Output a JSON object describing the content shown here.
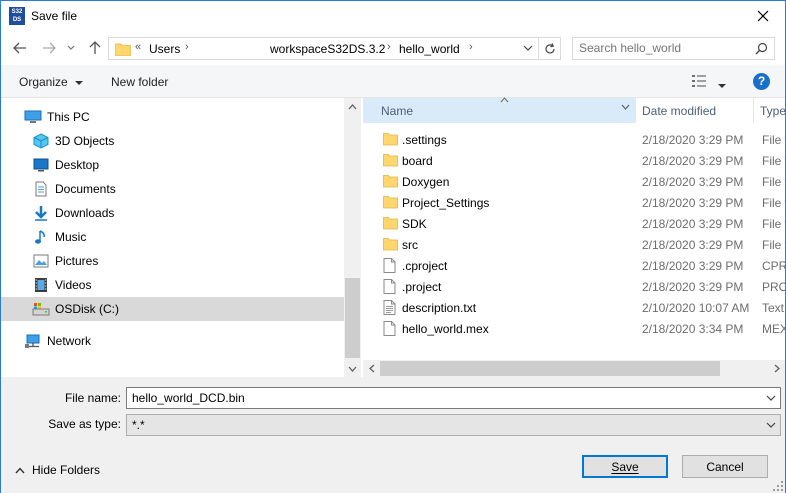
{
  "window": {
    "title": "Save file",
    "app_icon_text": "S32DS",
    "close_glyph": "✕"
  },
  "address": {
    "overflow_glyph": "«",
    "crumbs": [
      "Users",
      "workspaceS32DS.3.2",
      "hello_world"
    ],
    "separator": "›"
  },
  "search": {
    "placeholder": "Search hello_world"
  },
  "toolbar": {
    "organize_label": "Organize",
    "new_folder_label": "New folder",
    "help_glyph": "?"
  },
  "nav_pane": {
    "items": [
      {
        "label": "This PC",
        "icon": "this-pc-icon"
      },
      {
        "label": "3D Objects",
        "icon": "3d-objects-icon"
      },
      {
        "label": "Desktop",
        "icon": "desktop-icon"
      },
      {
        "label": "Documents",
        "icon": "documents-icon"
      },
      {
        "label": "Downloads",
        "icon": "downloads-icon"
      },
      {
        "label": "Music",
        "icon": "music-icon"
      },
      {
        "label": "Pictures",
        "icon": "pictures-icon"
      },
      {
        "label": "Videos",
        "icon": "videos-icon"
      },
      {
        "label": "OSDisk (C:)",
        "icon": "drive-icon"
      },
      {
        "label": "Network",
        "icon": "network-icon"
      }
    ]
  },
  "file_list": {
    "columns": {
      "name": "Name",
      "date": "Date modified",
      "type": "Type"
    },
    "rows": [
      {
        "name": ".settings",
        "date": "2/18/2020 3:29 PM",
        "type": "File f",
        "kind": "folder"
      },
      {
        "name": "board",
        "date": "2/18/2020 3:29 PM",
        "type": "File f",
        "kind": "folder"
      },
      {
        "name": "Doxygen",
        "date": "2/18/2020 3:29 PM",
        "type": "File f",
        "kind": "folder"
      },
      {
        "name": "Project_Settings",
        "date": "2/18/2020 3:29 PM",
        "type": "File f",
        "kind": "folder"
      },
      {
        "name": "SDK",
        "date": "2/18/2020 3:29 PM",
        "type": "File f",
        "kind": "folder"
      },
      {
        "name": "src",
        "date": "2/18/2020 3:29 PM",
        "type": "File f",
        "kind": "folder"
      },
      {
        "name": ".cproject",
        "date": "2/18/2020 3:29 PM",
        "type": "CPRO",
        "kind": "file"
      },
      {
        "name": ".project",
        "date": "2/18/2020 3:29 PM",
        "type": "PRO.",
        "kind": "file"
      },
      {
        "name": "description.txt",
        "date": "2/10/2020 10:07 AM",
        "type": "Text",
        "kind": "text"
      },
      {
        "name": "hello_world.mex",
        "date": "2/18/2020 3:34 PM",
        "type": "MEX",
        "kind": "file"
      }
    ]
  },
  "form": {
    "file_name_label": "File name:",
    "file_name_value": "hello_world_DCD.bin",
    "save_as_type_label": "Save as type:",
    "save_as_type_value": "*.*"
  },
  "footer": {
    "hide_folders_label": "Hide Folders",
    "save_label": "Save",
    "cancel_label": "Cancel"
  },
  "colors": {
    "accent": "#0078d7",
    "folder": "#ffd76e",
    "header_selected": "#d9ebf9",
    "nav_selected": "#d9d9d9"
  }
}
